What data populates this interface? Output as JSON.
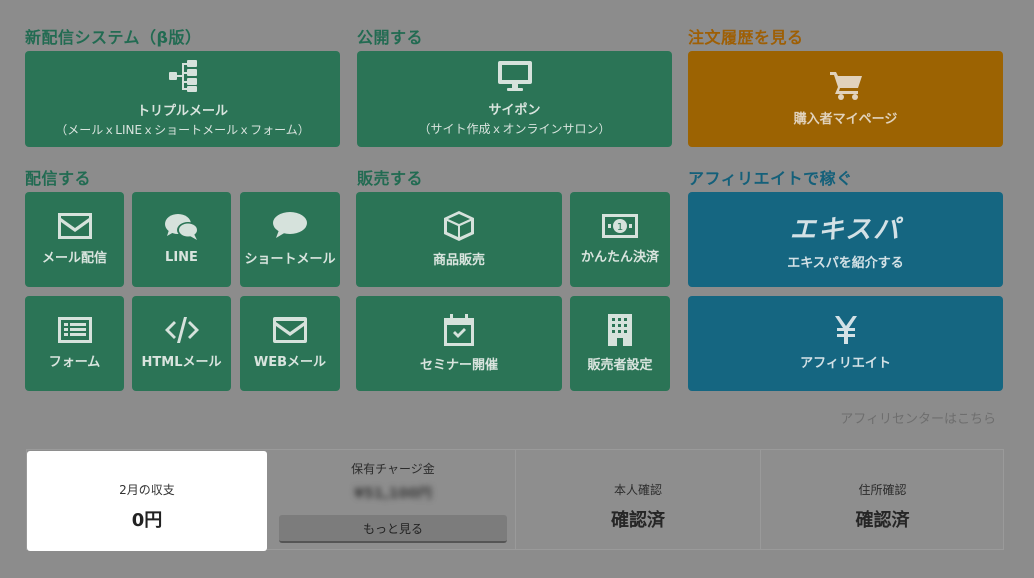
{
  "sections": {
    "new_delivery": "新配信システム（β版）",
    "publish": "公開する",
    "order_history": "注文履歴を見る",
    "deliver": "配信する",
    "sell": "販売する",
    "affiliate": "アフィリエイトで稼ぐ"
  },
  "tiles": {
    "triple_mail": {
      "label": "トリプルメール",
      "sub": "（メールｘLINEｘショートメールｘフォーム）",
      "icon": "sitemap-icon"
    },
    "site": {
      "label": "サイポン",
      "sub": "（サイト作成ｘオンラインサロン）",
      "icon": "monitor-icon"
    },
    "buyer_page": {
      "label": "購入者マイページ",
      "icon": "cart-icon"
    },
    "mail": {
      "label": "メール配信",
      "icon": "envelope-icon"
    },
    "line": {
      "label": "LINE",
      "icon": "chat-icon"
    },
    "sms": {
      "label": "ショートメール",
      "icon": "speech-bubble-icon"
    },
    "product": {
      "label": "商品販売",
      "icon": "box-icon"
    },
    "payment": {
      "label": "かんたん決済",
      "icon": "money-icon"
    },
    "exispa": {
      "logo": "エキスパ",
      "label": "エキスパを紹介する"
    },
    "form": {
      "label": "フォーム",
      "icon": "form-icon"
    },
    "html_mail": {
      "label": "HTMLメール",
      "icon": "code-icon"
    },
    "web_mail": {
      "label": "WEBメール",
      "icon": "envelope-icon"
    },
    "seminar": {
      "label": "セミナー開催",
      "icon": "calendar-check-icon"
    },
    "seller_settings": {
      "label": "販売者設定",
      "icon": "building-icon"
    },
    "affiliate": {
      "label": "アフィリエイト",
      "icon": "yen-icon"
    }
  },
  "affiliate_center_link": "アフィリセンターはこちら",
  "stats": {
    "income": {
      "label": "2月の収支",
      "value": "0円"
    },
    "charge": {
      "label": "保有チャージ金",
      "value": "¥51,100円",
      "button": "もっと見る"
    },
    "identity": {
      "label": "本人確認",
      "value": "確認済"
    },
    "address": {
      "label": "住所確認",
      "value": "確認済"
    }
  },
  "colors": {
    "green": "#2b7456",
    "orange": "#9c6302",
    "blue": "#156681",
    "overlay": "#8c8c8c"
  }
}
